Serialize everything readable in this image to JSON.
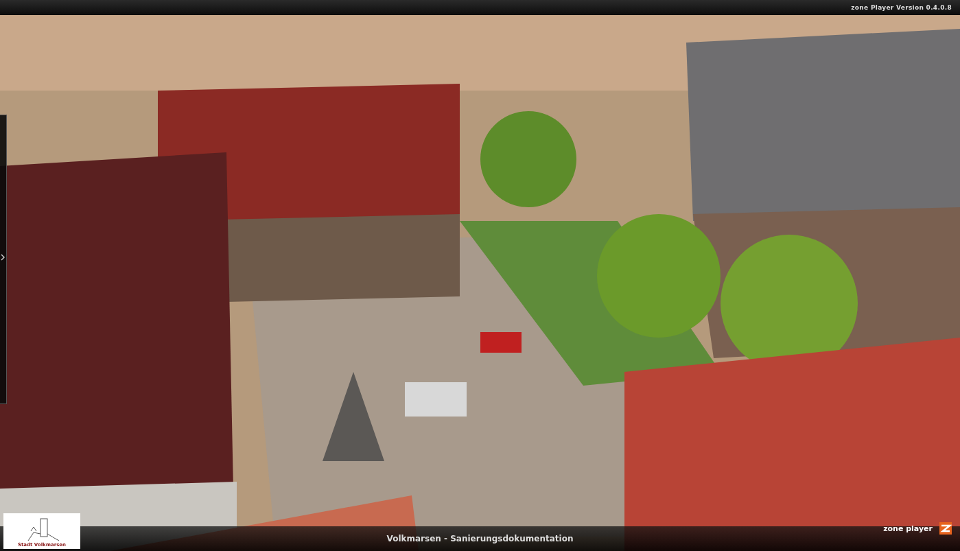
{
  "header": {
    "version": "zone Player Version 0.4.0.8"
  },
  "side_panel": {
    "expanded": false
  },
  "logo": {
    "caption": "Stadt Volkmarsen"
  },
  "footer": {
    "title": "Volkmarsen - Sanierungsdokumentation",
    "brand": "zone player"
  }
}
